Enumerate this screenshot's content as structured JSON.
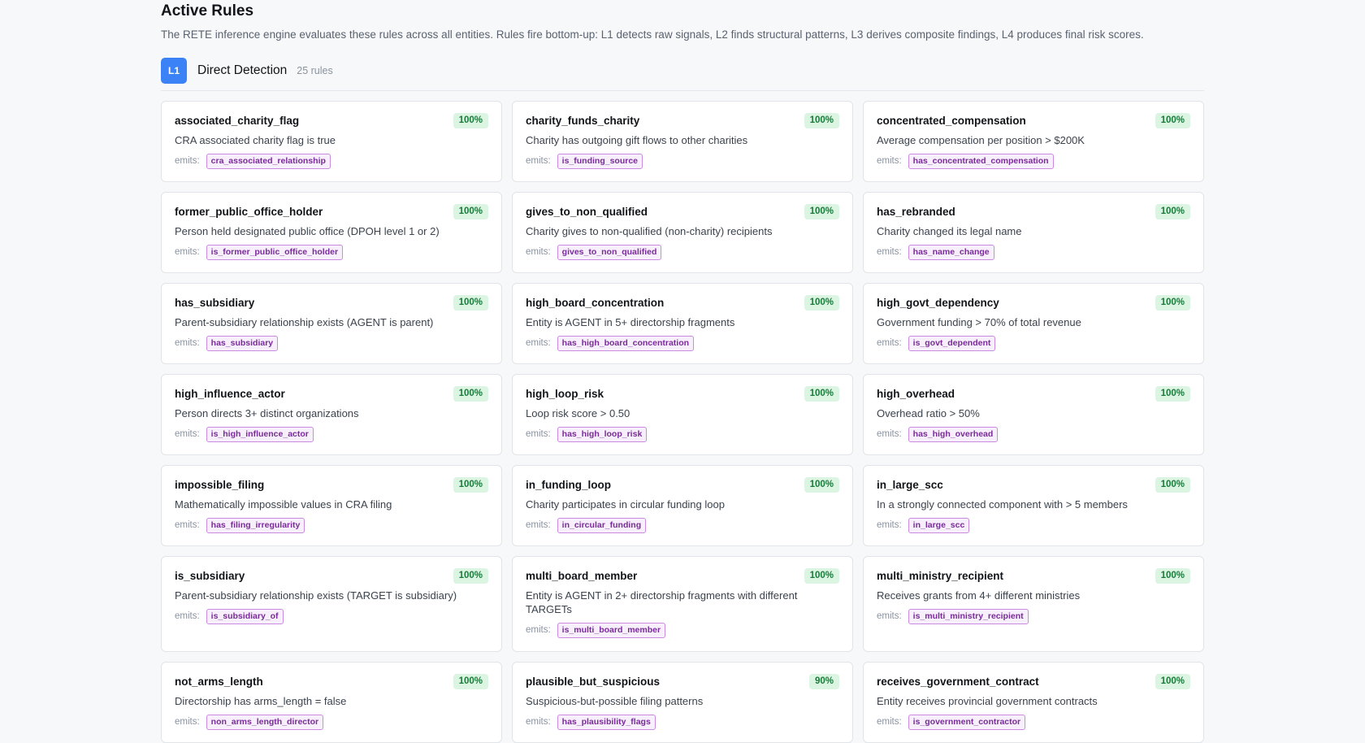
{
  "page": {
    "title": "Active Rules",
    "description": "The RETE inference engine evaluates these rules across all entities. Rules fire bottom-up: L1 detects raw signals, L2 finds structural patterns, L3 derives composite findings, L4 produces final risk scores."
  },
  "section": {
    "badge": "L1",
    "title": "Direct Detection",
    "count": "25 rules",
    "emits_label": "emits:"
  },
  "colors": {
    "badge_bg": "#3b82f6",
    "confidence_bg": "#dcf5e3",
    "confidence_text": "#1a7a3a",
    "emit_tag_text": "#7a2a9a",
    "emit_tag_border": "#c98ae0"
  },
  "rules": [
    {
      "name": "associated_charity_flag",
      "confidence": "100%",
      "description": "CRA associated charity flag is true",
      "emits": "cra_associated_relationship"
    },
    {
      "name": "charity_funds_charity",
      "confidence": "100%",
      "description": "Charity has outgoing gift flows to other charities",
      "emits": "is_funding_source"
    },
    {
      "name": "concentrated_compensation",
      "confidence": "100%",
      "description": "Average compensation per position > $200K",
      "emits": "has_concentrated_compensation"
    },
    {
      "name": "former_public_office_holder",
      "confidence": "100%",
      "description": "Person held designated public office (DPOH level 1 or 2)",
      "emits": "is_former_public_office_holder"
    },
    {
      "name": "gives_to_non_qualified",
      "confidence": "100%",
      "description": "Charity gives to non-qualified (non-charity) recipients",
      "emits": "gives_to_non_qualified"
    },
    {
      "name": "has_rebranded",
      "confidence": "100%",
      "description": "Charity changed its legal name",
      "emits": "has_name_change"
    },
    {
      "name": "has_subsidiary",
      "confidence": "100%",
      "description": "Parent-subsidiary relationship exists (AGENT is parent)",
      "emits": "has_subsidiary"
    },
    {
      "name": "high_board_concentration",
      "confidence": "100%",
      "description": "Entity is AGENT in 5+ directorship fragments",
      "emits": "has_high_board_concentration"
    },
    {
      "name": "high_govt_dependency",
      "confidence": "100%",
      "description": "Government funding > 70% of total revenue",
      "emits": "is_govt_dependent"
    },
    {
      "name": "high_influence_actor",
      "confidence": "100%",
      "description": "Person directs 3+ distinct organizations",
      "emits": "is_high_influence_actor"
    },
    {
      "name": "high_loop_risk",
      "confidence": "100%",
      "description": "Loop risk score > 0.50",
      "emits": "has_high_loop_risk"
    },
    {
      "name": "high_overhead",
      "confidence": "100%",
      "description": "Overhead ratio > 50%",
      "emits": "has_high_overhead"
    },
    {
      "name": "impossible_filing",
      "confidence": "100%",
      "description": "Mathematically impossible values in CRA filing",
      "emits": "has_filing_irregularity"
    },
    {
      "name": "in_funding_loop",
      "confidence": "100%",
      "description": "Charity participates in circular funding loop",
      "emits": "in_circular_funding"
    },
    {
      "name": "in_large_scc",
      "confidence": "100%",
      "description": "In a strongly connected component with > 5 members",
      "emits": "in_large_scc"
    },
    {
      "name": "is_subsidiary",
      "confidence": "100%",
      "description": "Parent-subsidiary relationship exists (TARGET is subsidiary)",
      "emits": "is_subsidiary_of"
    },
    {
      "name": "multi_board_member",
      "confidence": "100%",
      "description": "Entity is AGENT in 2+ directorship fragments with different TARGETs",
      "emits": "is_multi_board_member"
    },
    {
      "name": "multi_ministry_recipient",
      "confidence": "100%",
      "description": "Receives grants from 4+ different ministries",
      "emits": "is_multi_ministry_recipient"
    },
    {
      "name": "not_arms_length",
      "confidence": "100%",
      "description": "Directorship has arms_length = false",
      "emits": "non_arms_length_director"
    },
    {
      "name": "plausible_but_suspicious",
      "confidence": "90%",
      "description": "Suspicious-but-possible filing patterns",
      "emits": "has_plausibility_flags"
    },
    {
      "name": "receives_government_contract",
      "confidence": "100%",
      "description": "Entity receives provincial government contracts",
      "emits": "is_government_contractor"
    }
  ]
}
